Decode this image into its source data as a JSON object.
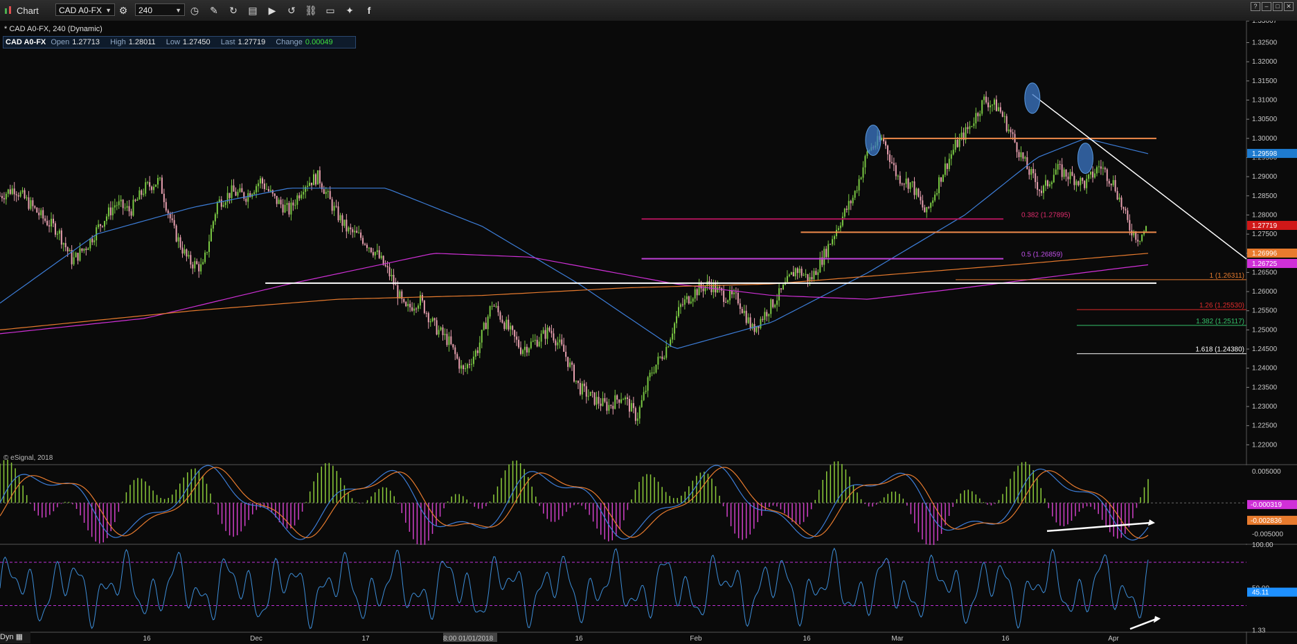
{
  "toolbar": {
    "app_title": "Chart",
    "symbol_value": "CAD A0-FX",
    "interval_value": "240",
    "icons": [
      "settings-icon",
      "clock-icon",
      "pencil-icon",
      "refresh-icon",
      "ticker-icon",
      "play-icon",
      "replay-icon",
      "link-icon",
      "comment-icon",
      "twitter-icon",
      "facebook-icon"
    ],
    "window_buttons": [
      "?",
      "–",
      "□",
      "✕"
    ]
  },
  "chart_header": {
    "symbol_line": "* CAD A0-FX, 240 (Dynamic)",
    "symbol": "CAD A0-FX",
    "open_label": "Open",
    "open_value": "1.27713",
    "high_label": "High",
    "high_value": "1.28011",
    "low_label": "Low",
    "low_value": "1.27450",
    "last_label": "Last",
    "last_value": "1.27719",
    "change_label": "Change",
    "change_value": "0.00049",
    "copyright": "© eSignal, 2018"
  },
  "colors": {
    "background": "#0a0a0a",
    "up_candle": "#7ac943",
    "down_candle": "#e8a0b0",
    "ma_blue": "#3d7ed9",
    "ma_magenta": "#d030d8",
    "ma_orange": "#e87b2e",
    "resistance": "#f08a4b",
    "support_white": "#ffffff",
    "fib_red": "#e02c2c",
    "fib_green": "#35c26a"
  },
  "chart_data": [
    {
      "type": "candlestick",
      "title": "CAD A0-FX, 240 (Dynamic)",
      "ylim": [
        1.215,
        1.3307
      ],
      "y_ticks": [
        "1.33067",
        "1.32500",
        "1.32000",
        "1.31500",
        "1.31000",
        "1.30500",
        "1.30000",
        "1.29500",
        "1.29000",
        "1.28500",
        "1.28000",
        "1.27500",
        "1.27000",
        "1.26500",
        "1.26000",
        "1.25500",
        "1.25000",
        "1.24500",
        "1.24000",
        "1.23500",
        "1.23000",
        "1.22500",
        "1.22000"
      ],
      "x_ticks": [
        "16",
        "Dec",
        "17",
        "8:00 01/01/2018",
        "16",
        "Feb",
        "16",
        "Mar",
        "16",
        "Apr"
      ],
      "price_path": [
        [
          0,
          1.285
        ],
        [
          3,
          1.287
        ],
        [
          6,
          1.283
        ],
        [
          9,
          1.279
        ],
        [
          12,
          1.276
        ],
        [
          15,
          1.268
        ],
        [
          18,
          1.272
        ],
        [
          21,
          1.278
        ],
        [
          24,
          1.283
        ],
        [
          27,
          1.281
        ],
        [
          30,
          1.287
        ],
        [
          33,
          1.289
        ],
        [
          36,
          1.276
        ],
        [
          39,
          1.268
        ],
        [
          42,
          1.266
        ],
        [
          45,
          1.283
        ],
        [
          48,
          1.286
        ],
        [
          51,
          1.285
        ],
        [
          54,
          1.289
        ],
        [
          57,
          1.284
        ],
        [
          60,
          1.281
        ],
        [
          63,
          1.288
        ],
        [
          66,
          1.29
        ],
        [
          69,
          1.282
        ],
        [
          72,
          1.276
        ],
        [
          75,
          1.274
        ],
        [
          78,
          1.27
        ],
        [
          81,
          1.264
        ],
        [
          84,
          1.255
        ],
        [
          87,
          1.258
        ],
        [
          90,
          1.251
        ],
        [
          93,
          1.247
        ],
        [
          96,
          1.239
        ],
        [
          99,
          1.245
        ],
        [
          102,
          1.257
        ],
        [
          105,
          1.251
        ],
        [
          108,
          1.245
        ],
        [
          111,
          1.247
        ],
        [
          114,
          1.25
        ],
        [
          117,
          1.244
        ],
        [
          120,
          1.235
        ],
        [
          123,
          1.232
        ],
        [
          126,
          1.23
        ],
        [
          129,
          1.233
        ],
        [
          132,
          1.227
        ],
        [
          135,
          1.239
        ],
        [
          138,
          1.245
        ],
        [
          141,
          1.256
        ],
        [
          144,
          1.26
        ],
        [
          147,
          1.262
        ],
        [
          150,
          1.259
        ],
        [
          153,
          1.258
        ],
        [
          156,
          1.25
        ],
        [
          159,
          1.255
        ],
        [
          162,
          1.26
        ],
        [
          165,
          1.266
        ],
        [
          168,
          1.263
        ],
        [
          171,
          1.27
        ],
        [
          174,
          1.278
        ],
        [
          177,
          1.285
        ],
        [
          180,
          1.297
        ],
        [
          183,
          1.3
        ],
        [
          186,
          1.29
        ],
        [
          189,
          1.288
        ],
        [
          192,
          1.28
        ],
        [
          195,
          1.29
        ],
        [
          198,
          1.298
        ],
        [
          201,
          1.303
        ],
        [
          204,
          1.31
        ],
        [
          207,
          1.308
        ],
        [
          210,
          1.3
        ],
        [
          213,
          1.292
        ],
        [
          216,
          1.286
        ],
        [
          219,
          1.292
        ],
        [
          222,
          1.29
        ],
        [
          225,
          1.288
        ],
        [
          228,
          1.293
        ],
        [
          231,
          1.288
        ],
        [
          234,
          1.277
        ],
        [
          236,
          1.274
        ],
        [
          238,
          1.277
        ]
      ],
      "series": [
        {
          "name": "MA blue",
          "color": "#3d7ed9",
          "values": [
            [
              0,
              1.257
            ],
            [
              20,
              1.275
            ],
            [
              40,
              1.282
            ],
            [
              60,
              1.287
            ],
            [
              80,
              1.287
            ],
            [
              100,
              1.277
            ],
            [
              120,
              1.262
            ],
            [
              140,
              1.245
            ],
            [
              160,
              1.252
            ],
            [
              180,
              1.265
            ],
            [
              200,
              1.28
            ],
            [
              215,
              1.295
            ],
            [
              225,
              1.3
            ],
            [
              238,
              1.296
            ]
          ]
        },
        {
          "name": "MA magenta",
          "color": "#d030d8",
          "values": [
            [
              0,
              1.249
            ],
            [
              30,
              1.253
            ],
            [
              60,
              1.262
            ],
            [
              90,
              1.27
            ],
            [
              110,
              1.269
            ],
            [
              140,
              1.262
            ],
            [
              160,
              1.259
            ],
            [
              180,
              1.258
            ],
            [
              200,
              1.261
            ],
            [
              225,
              1.265
            ],
            [
              238,
              1.267
            ]
          ]
        },
        {
          "name": "MA orange",
          "color": "#e87b2e",
          "values": [
            [
              0,
              1.25
            ],
            [
              40,
              1.255
            ],
            [
              70,
              1.258
            ],
            [
              100,
              1.259
            ],
            [
              130,
              1.261
            ],
            [
              160,
              1.262
            ],
            [
              190,
              1.265
            ],
            [
              210,
              1.267
            ],
            [
              238,
              1.27
            ]
          ]
        }
      ],
      "horizontal_levels": [
        {
          "price": 1.3,
          "color": "#f08a4b",
          "x_range": [
            183,
            240
          ]
        },
        {
          "price": 1.2755,
          "color": "#f08a4b",
          "x_range": [
            166,
            240
          ]
        },
        {
          "price": 1.2622,
          "color": "#ffffff",
          "x_range": [
            55,
            240
          ]
        },
        {
          "price": 1.27895,
          "color": "#b0145a",
          "x_range": [
            133,
            208
          ]
        },
        {
          "price": 1.26859,
          "color": "#c040d8",
          "x_range": [
            133,
            208
          ]
        }
      ],
      "trendline": [
        [
          214,
          1.3115
        ],
        [
          268,
          1.2685
        ]
      ],
      "fib_labels": [
        {
          "text": "0.382 (1.27895)",
          "price": 1.27895,
          "color": "#e02c6c"
        },
        {
          "text": "0.5 (1.26859)",
          "price": 1.26859,
          "color": "#c050e8"
        },
        {
          "text": "1 (1.26311)",
          "price": 1.26311,
          "color": "#e87b2e"
        },
        {
          "text": "1.26 (1.25530)",
          "price": 1.2553,
          "color": "#e02c2c"
        },
        {
          "text": "1.382 (1.25117)",
          "price": 1.25117,
          "color": "#35c26a"
        },
        {
          "text": "1.618 (1.24380)",
          "price": 1.2438,
          "color": "#ffffff"
        }
      ],
      "price_tags": [
        {
          "text": "1.29598",
          "value": 1.29598,
          "color": "#1e7bd0"
        },
        {
          "text": "1.27719",
          "value": 1.27719,
          "color": "#d01818"
        },
        {
          "text": "1.26996",
          "value": 1.26996,
          "color": "#e87b2e"
        },
        {
          "text": "1.26725",
          "value": 1.26725,
          "color": "#d030d8"
        }
      ]
    },
    {
      "type": "line",
      "title": "",
      "ylim": [
        -0.0065,
        0.006
      ],
      "y_ticks": [
        "0.005000",
        "-0.005000"
      ],
      "value_tags": [
        {
          "text": "-0.000319",
          "value": -0.000319,
          "color": "#d030d8"
        },
        {
          "text": "-0.002836",
          "value": -0.002836,
          "color": "#e87b2e"
        }
      ]
    },
    {
      "type": "line",
      "title": "",
      "ylim": [
        0,
        100
      ],
      "y_ticks": [
        "100.00",
        "50.00",
        "1.33"
      ],
      "value_tags": [
        {
          "text": "45.11",
          "value": 45.11,
          "color": "#1e90ff"
        }
      ]
    }
  ],
  "footer": {
    "label": "Dyn"
  }
}
